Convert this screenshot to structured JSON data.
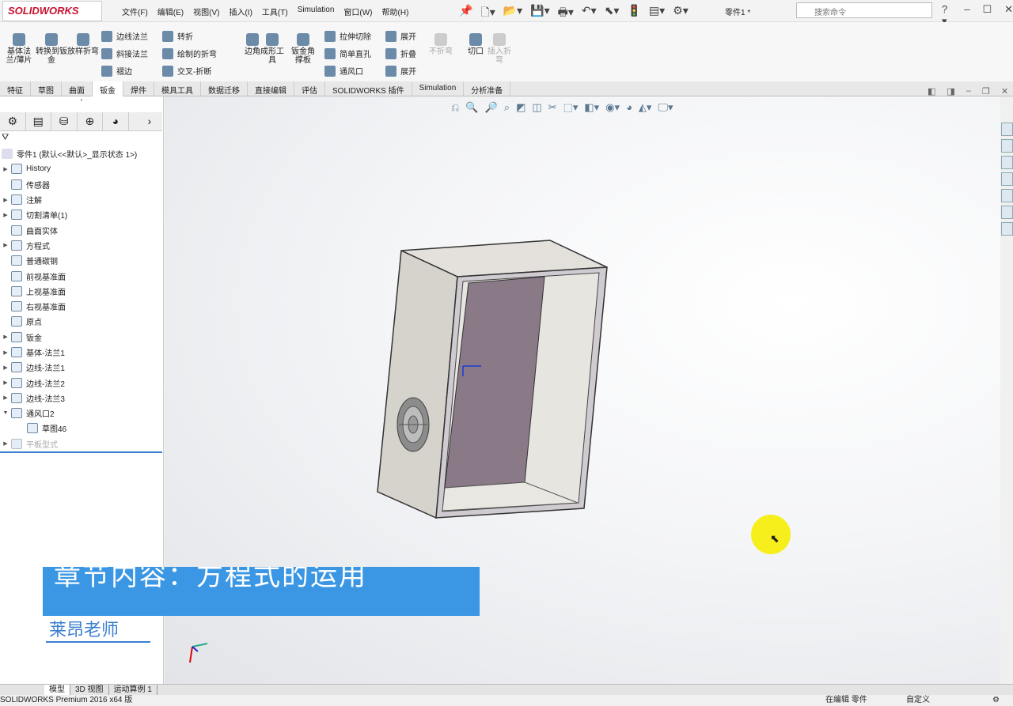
{
  "app": {
    "logo": "SOLIDWORKS",
    "document_title": "零件1 *",
    "search_placeholder": "搜索命令"
  },
  "menu": [
    "文件(F)",
    "编辑(E)",
    "视图(V)",
    "插入(I)",
    "工具(T)",
    "Simulation",
    "窗口(W)",
    "帮助(H)"
  ],
  "ribbon": {
    "large": [
      {
        "label": "基体法兰/薄片"
      },
      {
        "label": "转换到钣金"
      },
      {
        "label": "放样折弯"
      },
      {
        "label": "边角"
      },
      {
        "label": "成形工具"
      },
      {
        "label": "钣金角撑板"
      },
      {
        "label": "不折弯",
        "disabled": true
      },
      {
        "label": "切口"
      },
      {
        "label": "插入折弯",
        "disabled": true
      }
    ],
    "small": [
      "边线法兰",
      "斜接法兰",
      "褶边",
      "转折",
      "绘制的折弯",
      "交叉-折断",
      "拉伸切除",
      "简单直孔",
      "通风口",
      "展开",
      "折叠",
      "展开"
    ]
  },
  "tabs": [
    "特征",
    "草图",
    "曲面",
    "钣金",
    "焊件",
    "模具工具",
    "数据迁移",
    "直接编辑",
    "评估",
    "SOLIDWORKS 插件",
    "Simulation",
    "分析准备"
  ],
  "active_tab": "钣金",
  "tree": {
    "root": "零件1  (默认<<默认>_显示状态 1>)",
    "items": [
      {
        "label": "History",
        "expand": true
      },
      {
        "label": "传感器",
        "expand": false
      },
      {
        "label": "注解",
        "expand": true
      },
      {
        "label": "切割清单(1)",
        "expand": true
      },
      {
        "label": "曲面实体",
        "expand": false
      },
      {
        "label": "方程式",
        "expand": true
      },
      {
        "label": "普通碳钢",
        "expand": false
      },
      {
        "label": "前视基准面",
        "expand": false
      },
      {
        "label": "上视基准面",
        "expand": false
      },
      {
        "label": "右视基准面",
        "expand": false
      },
      {
        "label": "原点",
        "expand": false
      },
      {
        "label": "钣金",
        "expand": true
      },
      {
        "label": "基体-法兰1",
        "expand": true
      },
      {
        "label": "边线-法兰1",
        "expand": true
      },
      {
        "label": "边线-法兰2",
        "expand": true
      },
      {
        "label": "边线-法兰3",
        "expand": true
      },
      {
        "label": "通风口2",
        "expand": true,
        "open": true
      },
      {
        "label": "草图46",
        "child": true
      },
      {
        "label": "平板型式",
        "expand": true,
        "faded": true
      }
    ]
  },
  "overlay": {
    "banner": "章节内容：方程式的运用",
    "teacher": "莱昂老师"
  },
  "bottom_tabs": [
    "模型",
    "3D 视图",
    "运动算例 1"
  ],
  "status": {
    "left": "SOLIDWORKS Premium 2016 x64 版",
    "mode": "在编辑 零件",
    "units": "自定义"
  },
  "colors": {
    "accent": "#3b97e3",
    "highlight": "#f6ef1c",
    "panel": "#8a7a88"
  }
}
